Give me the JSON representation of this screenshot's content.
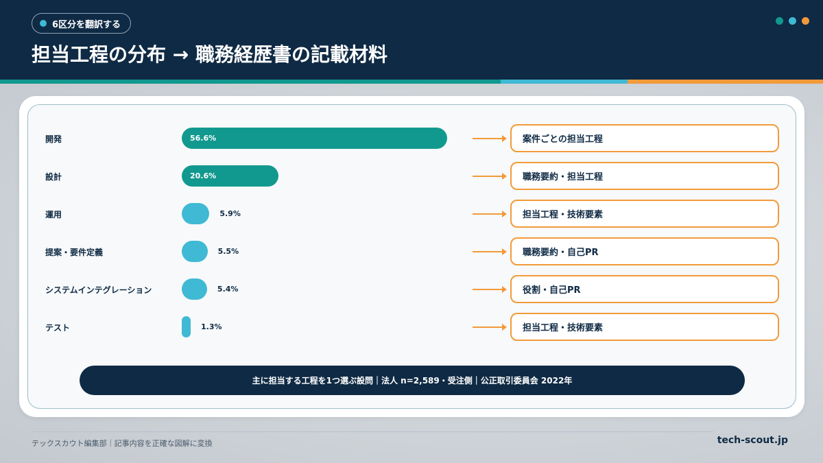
{
  "header": {
    "tag": "6区分を翻訳する",
    "title": "担当工程の分布 → 職務経歴書の記載材料"
  },
  "colors": {
    "navy": "#0f2a44",
    "teal": "#12998f",
    "cyan": "#3fb9d4",
    "orange": "#f29a3a"
  },
  "chart_data": {
    "type": "bar",
    "orientation": "horizontal",
    "categories": [
      "開発",
      "設計",
      "運用",
      "提案・要件定義",
      "システムインテグレーション",
      "テスト"
    ],
    "values": [
      56.6,
      20.6,
      5.9,
      5.5,
      5.4,
      1.3
    ],
    "value_labels": [
      "56.6%",
      "20.6%",
      "5.9%",
      "5.5%",
      "5.4%",
      "1.3%"
    ],
    "unit": "%",
    "xlim": [
      0,
      56.6
    ],
    "mappings": [
      "案件ごとの担当工程",
      "職務要約・担当工程",
      "担当工程・技術要素",
      "職務要約・自己PR",
      "役割・自己PR",
      "担当工程・技術要素"
    ],
    "source": "主に担当する工程を1つ選ぶ設問｜法人 n=2,589・受注側｜公正取引委員会 2022年"
  },
  "footer": {
    "left": "テックスカウト編集部｜記事内容を正確な図解に変換",
    "right": "tech-scout.jp"
  }
}
